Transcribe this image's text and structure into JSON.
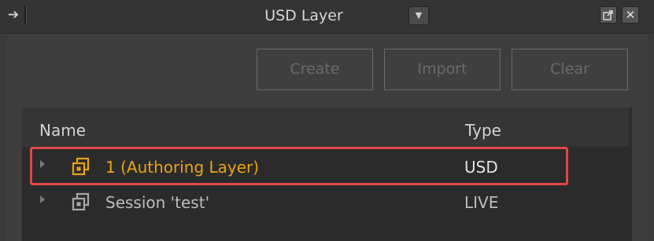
{
  "window": {
    "title": "USD Layer",
    "dock_icon": "dock-arrow-icon",
    "dropdown_icon": "chevron-down-icon",
    "undock_icon": "undock-icon",
    "close_icon": "close-icon",
    "close_glyph": "✕"
  },
  "toolbar": {
    "create_label": "Create",
    "import_label": "Import",
    "clear_label": "Clear",
    "buttons_enabled": false
  },
  "tree": {
    "columns": [
      "Name",
      "Type"
    ],
    "rows": [
      {
        "name": "1 (Authoring Layer)",
        "type": "USD",
        "icon": "usd-layer-icon",
        "authoring": true,
        "highlighted": true
      },
      {
        "name": "Session 'test'",
        "type": "LIVE",
        "icon": "session-layer-icon",
        "authoring": false,
        "highlighted": false
      }
    ]
  },
  "colors": {
    "authoring_layer": "#e8a317",
    "highlight_border": "#e04848",
    "background": "#3a3a3a",
    "tree_background": "#2b2b2b"
  }
}
